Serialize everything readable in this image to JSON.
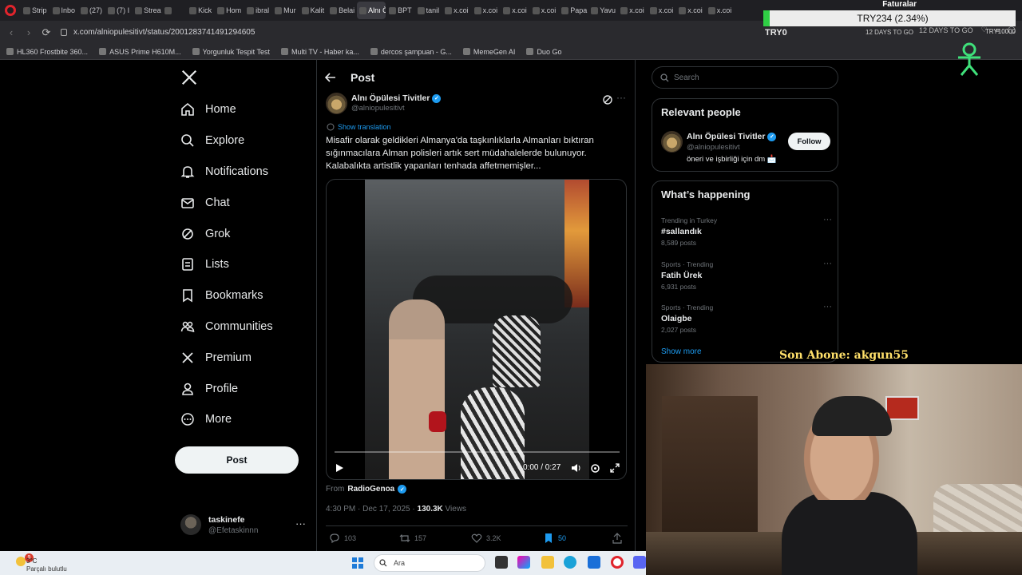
{
  "browser": {
    "tabs": [
      "Strip",
      "Inbo",
      "(27)",
      "(7) I",
      "Strea",
      "",
      "Kick",
      "Hom",
      "ibral",
      "Mur",
      "Kalit",
      "Belai",
      "Alnı Öpü",
      "BPT",
      "tanil",
      "x.coi",
      "x.coi",
      "x.coi",
      "x.coi",
      "Papa",
      "Yavu",
      "x.coi",
      "x.coi",
      "x.coi",
      "x.coi"
    ],
    "active_tab_index": 12,
    "url": "x.com/alniopulesitivt/status/2001283741491294605",
    "bookmarks": [
      "HL360 Frostbite 360...",
      "ASUS Prime H610M...",
      "Yorgunluk Tespit Test",
      "Multi TV - Haber ka...",
      "dercos şampuan - G...",
      "MemeGen AI",
      "Duo Go"
    ],
    "days_to_go": "12 DAYS TO GO"
  },
  "overlay": {
    "ticker_title": "Faturalar",
    "ticker_value": "TRY234 (2.34%)",
    "ticker_progress_pct": 2.34,
    "ticker_start": "TRY0",
    "ticker_goal": "TRY10000",
    "last_subscriber": "Son Abone: akgun55"
  },
  "sidebar": {
    "items": [
      {
        "label": "Home",
        "icon": "home-icon"
      },
      {
        "label": "Explore",
        "icon": "search-icon"
      },
      {
        "label": "Notifications",
        "icon": "bell-icon"
      },
      {
        "label": "Chat",
        "icon": "mail-icon"
      },
      {
        "label": "Grok",
        "icon": "grok-icon"
      },
      {
        "label": "Lists",
        "icon": "list-icon"
      },
      {
        "label": "Bookmarks",
        "icon": "bookmark-icon"
      },
      {
        "label": "Communities",
        "icon": "communities-icon"
      },
      {
        "label": "Premium",
        "icon": "x-icon"
      },
      {
        "label": "Profile",
        "icon": "person-icon"
      },
      {
        "label": "More",
        "icon": "more-circle-icon"
      }
    ],
    "post_button": "Post",
    "account": {
      "name": "taskinefe",
      "handle": "@Efetaskinnn"
    }
  },
  "post": {
    "header": "Post",
    "author_name": "Alnı Öpülesi Tivitler",
    "author_handle": "@alniopulesitivt",
    "show_translation": "Show translation",
    "text": "Misafir olarak geldikleri Almanya'da taşkınlıklarla Almanları bıktıran sığınmacılara Alman polisleri artık sert müdahalelerde bulunuyor. Kalabalıkta artistlik yapanları tenhada affetmemişler...",
    "video_time": "0:00 / 0:27",
    "from_label": "From",
    "from_source": "RadioGenoa",
    "timestamp": "4:30 PM · Dec 17, 2025",
    "views_count": "130.3K",
    "views_label": "Views",
    "replies": "103",
    "reposts": "157",
    "likes": "3.2K",
    "bookmarks": "50"
  },
  "right": {
    "search_placeholder": "Search",
    "relevant_title": "Relevant people",
    "relevant_person": {
      "name": "Alnı Öpülesi Tivitler",
      "handle": "@alniopulesitivt",
      "bio": "öneri ve işbirliği için dm 📩",
      "follow_label": "Follow"
    },
    "happening_title": "What’s happening",
    "trends": [
      {
        "context": "Trending in Turkey",
        "name": "#sallandık",
        "count": "8,589 posts"
      },
      {
        "context": "Sports · Trending",
        "name": "Fatih Ürek",
        "count": "6,931 posts"
      },
      {
        "context": "Sports · Trending",
        "name": "Olaigbe",
        "count": "2,027 posts"
      }
    ],
    "show_more": "Show more"
  },
  "taskbar": {
    "temperature": "3°C",
    "weather": "Parçalı bulutlu",
    "weather_badge": "9",
    "search_label": "Ara"
  },
  "colors": {
    "accent": "#1d9bf0",
    "background": "#000000",
    "ticker_green": "#2fcf45"
  }
}
